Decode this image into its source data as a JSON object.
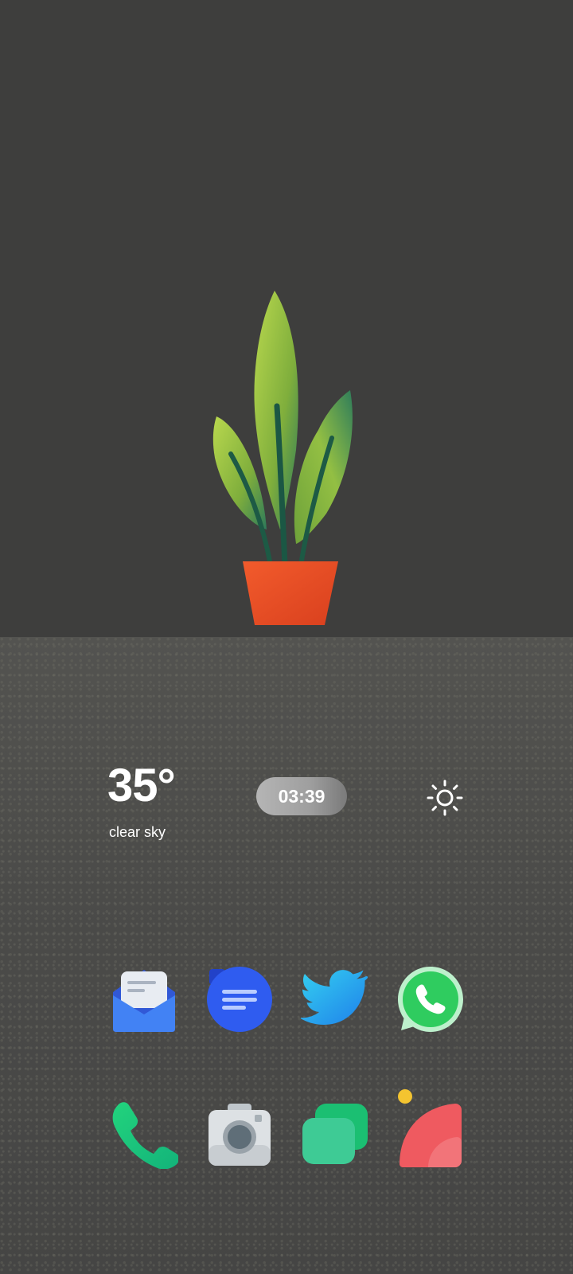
{
  "weather": {
    "temperature": "35°",
    "description": "clear sky",
    "icon": "sun-icon"
  },
  "clock": {
    "time": "03:39"
  },
  "apps_row1": [
    {
      "name": "email",
      "icon": "envelope-icon",
      "color": "#3d7cf2"
    },
    {
      "name": "notes",
      "icon": "notes-icon",
      "color": "#2f55f0"
    },
    {
      "name": "twitter",
      "icon": "bird-icon",
      "color": "#2aa4f4"
    },
    {
      "name": "whatsapp",
      "icon": "whatsapp-icon",
      "color": "#29c556"
    }
  ],
  "dock": [
    {
      "name": "phone",
      "icon": "phone-icon",
      "color": "#1fcf84"
    },
    {
      "name": "camera",
      "icon": "camera-icon",
      "color": "#d6dadd"
    },
    {
      "name": "messages",
      "icon": "chat-icon",
      "color": "#27c58b"
    },
    {
      "name": "gallery",
      "icon": "gallery-icon",
      "color": "#ef5a60"
    }
  ],
  "colors": {
    "pot": "#e94e27",
    "leaf_light": "#a4c644",
    "leaf_dark": "#1f5a45",
    "badge": "#f4c430"
  }
}
